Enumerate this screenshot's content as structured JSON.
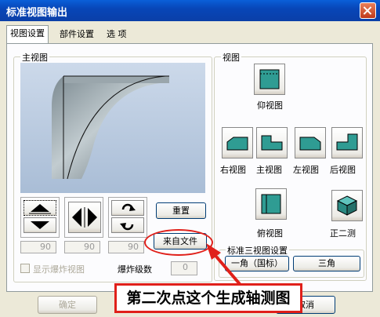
{
  "window": {
    "title": "标准视图输出"
  },
  "tabs": [
    {
      "label": "视图设置",
      "active": true
    },
    {
      "label": "部件设置"
    },
    {
      "label": "选 项"
    }
  ],
  "main_view": {
    "group_label": "主视图",
    "reset_label": "重置",
    "from_file_label": "来自文件",
    "numbers": [
      "90",
      "90",
      "90"
    ],
    "explode_checkbox_label": "显示爆炸视图",
    "explode_level_label": "爆炸级数",
    "explode_level_value": "0"
  },
  "views": {
    "group_label": "视图",
    "items": [
      "仰视图",
      "右视图",
      "主视图",
      "左视图",
      "后视图",
      "俯视图",
      "正二测"
    ]
  },
  "standard_three_view": {
    "group_label": "标准三视图设置",
    "first_angle": "一角（国标）",
    "third_angle": "三角"
  },
  "footer": {
    "ok": "确定",
    "cancel": "取消"
  },
  "annotation": {
    "text": "第二次点这个生成轴测图",
    "color": "#e0201a"
  }
}
